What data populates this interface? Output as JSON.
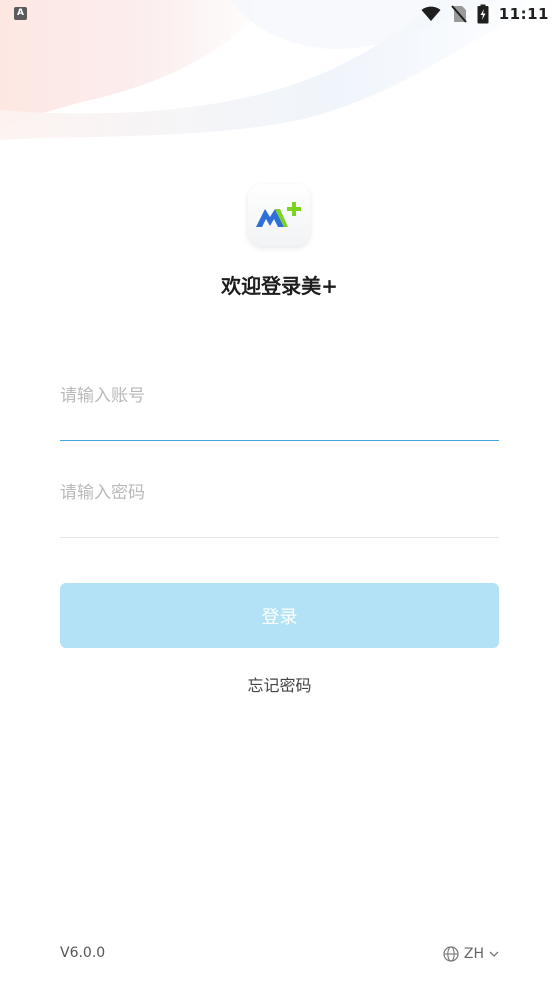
{
  "status_bar": {
    "left_badge": "A",
    "time": "11:11",
    "icons": [
      "wifi-icon",
      "no-sim-icon",
      "battery-charging-icon"
    ]
  },
  "app": {
    "logo_icon": "m-plus-logo",
    "welcome_title": "欢迎登录美+"
  },
  "login_form": {
    "account_placeholder": "请输入账号",
    "account_value": "",
    "password_placeholder": "请输入密码",
    "password_value": "",
    "submit_label": "登录",
    "forgot_label": "忘记密码"
  },
  "footer": {
    "version": "V6.0.0",
    "language": "ZH",
    "language_icon": "globe-icon"
  },
  "colors": {
    "accent": "#47a6df",
    "button_bg": "#b3e2f7",
    "logo_blue": "#2f6fd8",
    "logo_green": "#7ed321"
  }
}
